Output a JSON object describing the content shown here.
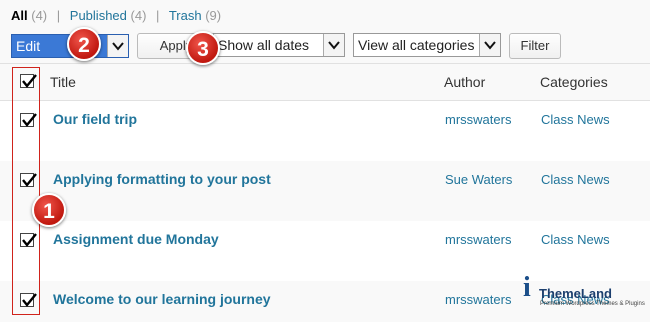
{
  "status_filters": {
    "all": {
      "label": "All",
      "count": "(4)"
    },
    "published": {
      "label": "Published",
      "count": "(4)"
    },
    "trash": {
      "label": "Trash",
      "count": "(9)"
    },
    "separator": "|"
  },
  "toolbar": {
    "bulk_action": "Edit",
    "apply_label": "Apply",
    "dates_filter": "Show all dates",
    "categories_filter": "View all categories",
    "filter_label": "Filter"
  },
  "table": {
    "columns": {
      "title": "Title",
      "author": "Author",
      "categories": "Categories"
    },
    "rows": [
      {
        "title": "Our field trip",
        "author": "mrsswaters",
        "category": "Class News",
        "checked": true
      },
      {
        "title": "Applying formatting to your post",
        "author": "Sue Waters",
        "category": "Class News",
        "checked": true
      },
      {
        "title": "Assignment due Monday",
        "author": "mrsswaters",
        "category": "Class News",
        "checked": true
      },
      {
        "title": "Welcome to our learning journey",
        "author": "mrsswaters",
        "category": "Class News",
        "checked": true
      }
    ]
  },
  "annotations": {
    "step1": "1",
    "step2": "2",
    "step3": "3",
    "highlight_color": "#d0231b"
  },
  "watermark": {
    "brand": "iThemeLand",
    "letter": "i",
    "name": "ThemeLand",
    "tagline": "Premium Wordpress Themes & Plugins"
  },
  "colors": {
    "link": "#21759b",
    "bulk_select_bg": "#3b79d6"
  }
}
